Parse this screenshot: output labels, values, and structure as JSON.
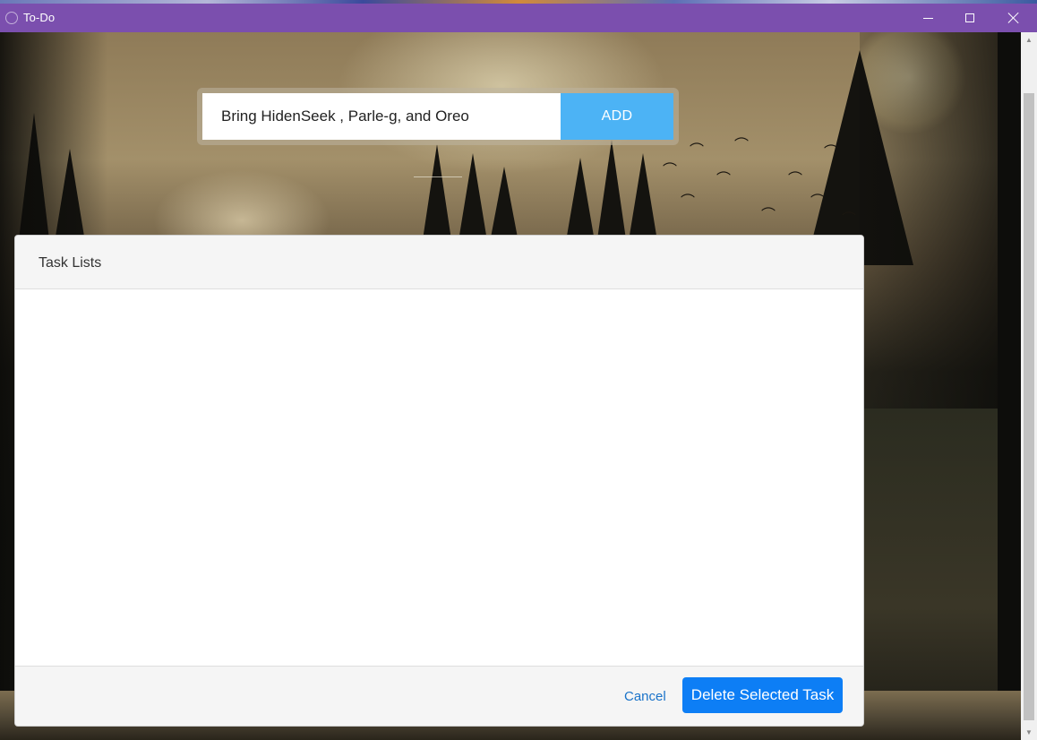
{
  "window": {
    "title": "To-Do",
    "controls": {
      "minimize": "minimize",
      "maximize": "maximize",
      "close": "close"
    }
  },
  "add_form": {
    "input_value": "Bring HidenSeek , Parle-g, and Oreo",
    "add_label": "ADD"
  },
  "task_modal": {
    "title": "Task Lists",
    "tasks": [],
    "cancel_label": "Cancel",
    "delete_label": "Delete Selected Task"
  },
  "colors": {
    "titlebar": "#7b4fae",
    "add_button": "#4cb3f5",
    "delete_button": "#0d7ef5",
    "cancel_link": "#1a73c9"
  },
  "icons": {
    "app": "app-icon",
    "scroll_up": "chevron-up-icon",
    "scroll_down": "chevron-down-icon"
  }
}
